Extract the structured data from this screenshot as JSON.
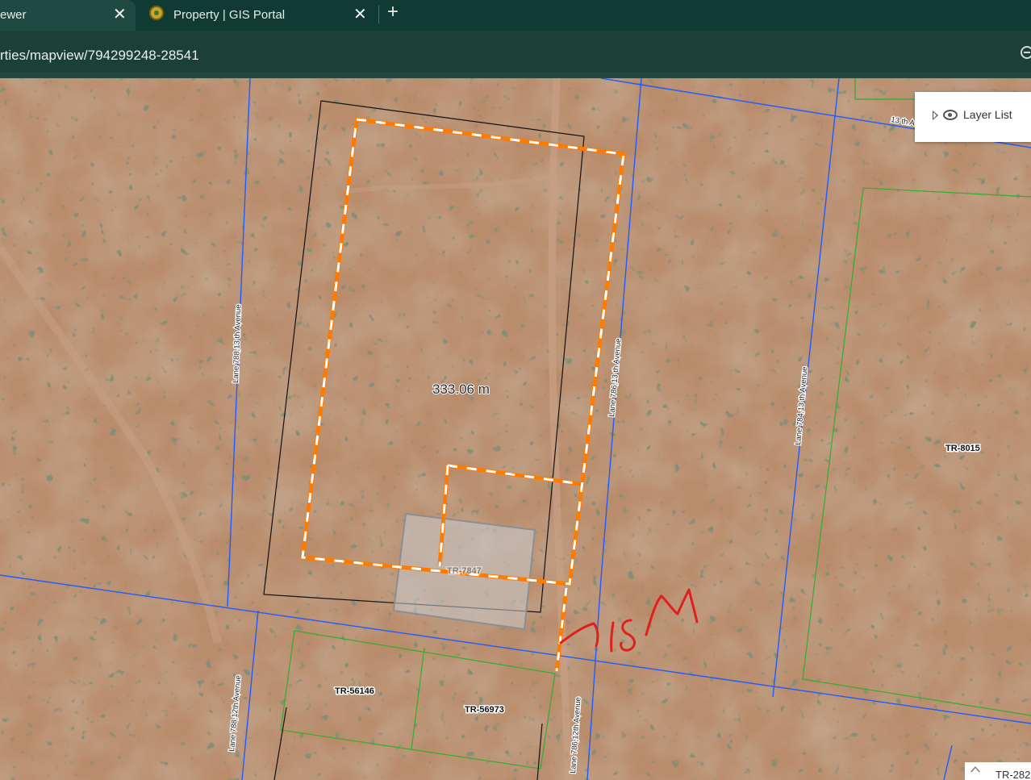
{
  "browser": {
    "tabs": [
      {
        "title": "ewer",
        "close": "✕"
      },
      {
        "title": "Property | GIS Portal",
        "close": "✕"
      }
    ],
    "new_tab": "+",
    "url": "rties/mapview/794299248-28541"
  },
  "map": {
    "layer_list_label": "Layer List",
    "measurement": "333.06 m",
    "roads": {
      "r788_13": "Lane 788,13 th Avenue",
      "r786_13": "Lane 786,13 th Avenue",
      "r784_13": "Lane 784,13 th Avenue",
      "r788_12": "Lane 788,12th Avenue",
      "r786_12": "Lane 786,12th Avenue",
      "ave13": "13 th Av"
    },
    "parcels": {
      "p8015": "TR-8015",
      "p56146": "TR-56146",
      "p56973": "TR-56973",
      "partial": "TR-7847"
    },
    "annotation": "15M",
    "corner_label": "TR-282"
  },
  "colors": {
    "road_line": "#1f5bff",
    "parcel_line": "#2fae2f",
    "selection_outline": "#ff7a00",
    "annotation": "#e0201c"
  }
}
